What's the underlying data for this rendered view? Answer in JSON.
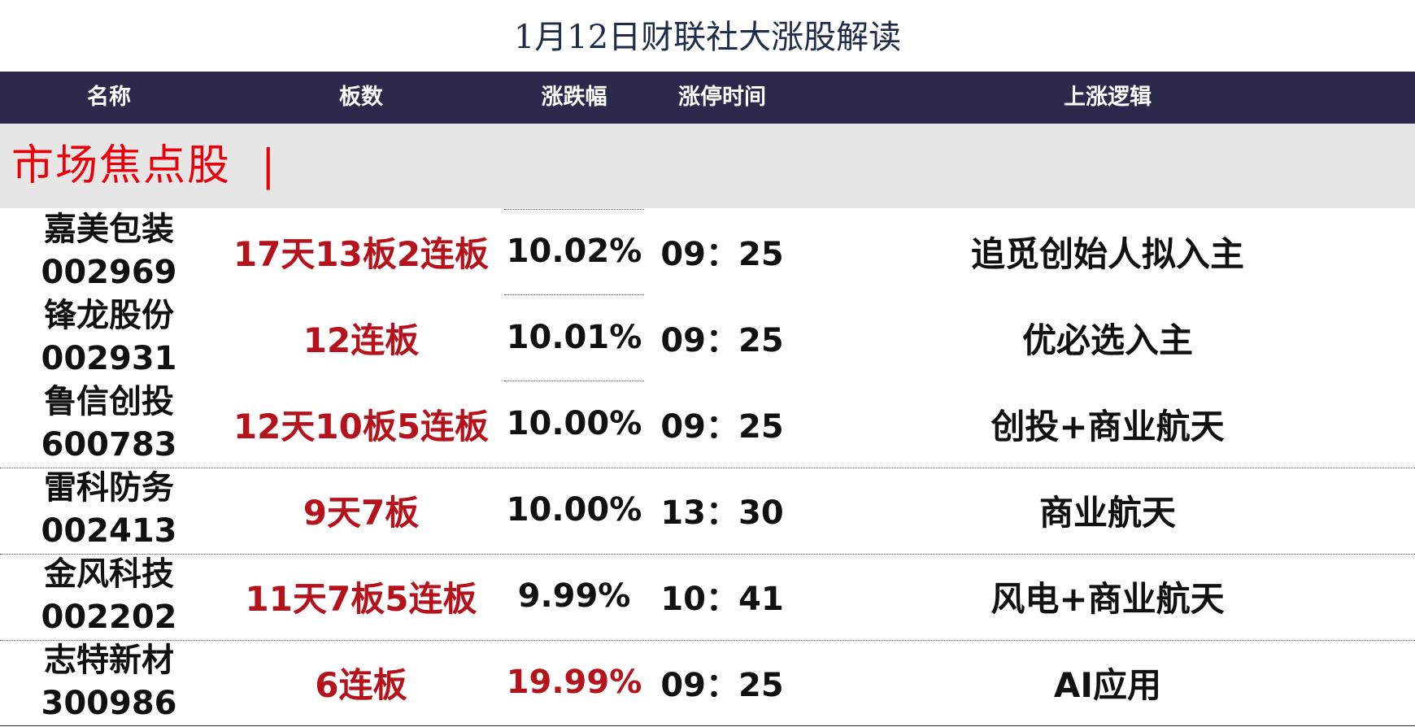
{
  "title": "1月12日财联社大涨股解读",
  "columns": [
    "名称",
    "板数",
    "涨跌幅",
    "涨停时间",
    "上涨逻辑"
  ],
  "section_label": "市场焦点股  |",
  "colors": {
    "header_bg": "#2b2a4c",
    "section_bg": "#e6e6e6",
    "accent_red": "#b5121b",
    "section_red": "#e8000b"
  },
  "rows": [
    {
      "name": "嘉美包装",
      "code": "002969",
      "boards": "17天13板2连板",
      "change": "10.02%",
      "time": "09：25",
      "logic": "追觅创始人拟入主"
    },
    {
      "name": "锋龙股份",
      "code": "002931",
      "boards": "12连板",
      "change": "10.01%",
      "time": "09：25",
      "logic": "优必选入主"
    },
    {
      "name": "鲁信创投",
      "code": "600783",
      "boards": "12天10板5连板",
      "change": "10.00%",
      "time": "09：25",
      "logic": "创投+商业航天"
    },
    {
      "name": "雷科防务",
      "code": "002413",
      "boards": "9天7板",
      "change": "10.00%",
      "time": "13：30",
      "logic": "商业航天"
    },
    {
      "name": "金风科技",
      "code": "002202",
      "boards": "11天7板5连板",
      "change": "9.99%",
      "time": "10：41",
      "logic": "风电+商业航天"
    },
    {
      "name": "志特新材",
      "code": "300986",
      "boards": "6连板",
      "change": "19.99%",
      "time": "09：25",
      "logic": "AI应用"
    }
  ]
}
